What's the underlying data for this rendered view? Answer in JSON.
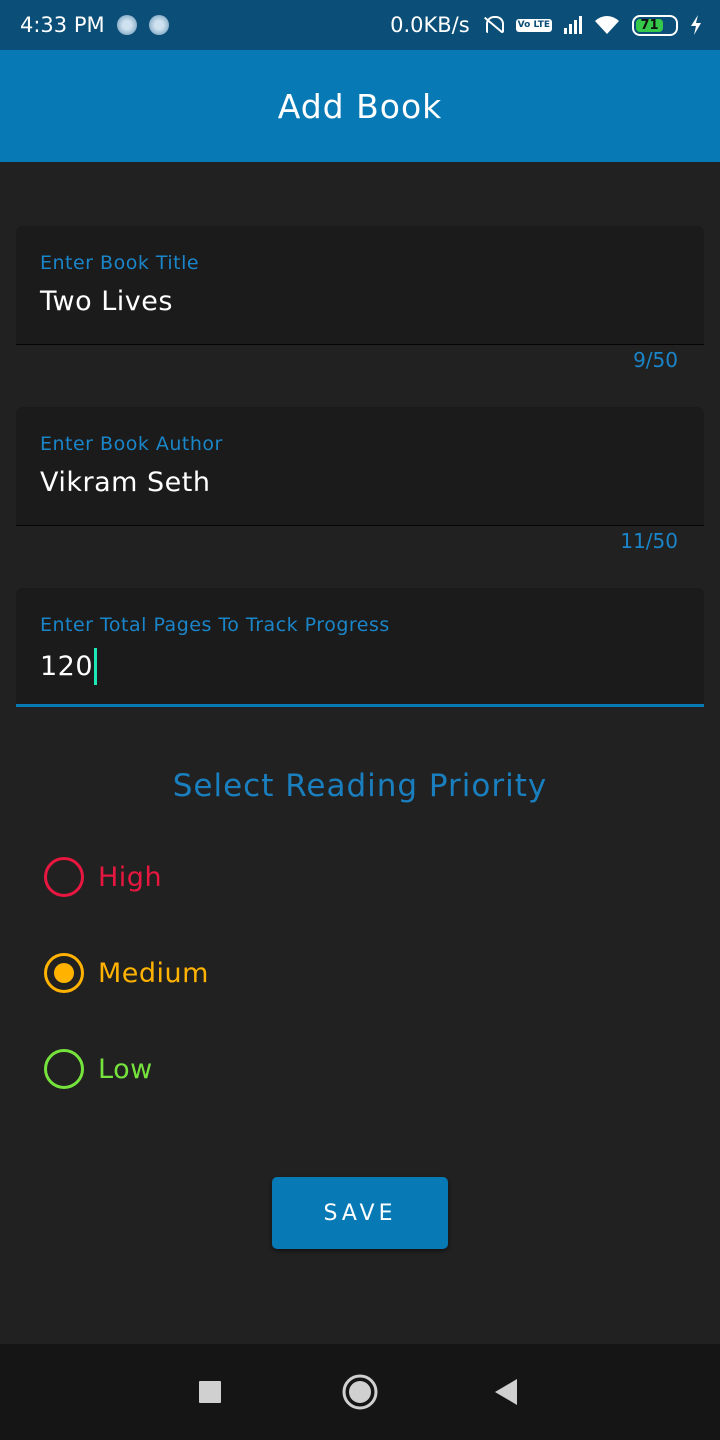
{
  "status_bar": {
    "time": "4:33 PM",
    "network_speed": "0.0KB/s",
    "battery_level": "71",
    "volte_label": "Vo LTE",
    "icons": [
      "sync-dot-icon",
      "sync-dot-icon",
      "mute-bell-icon",
      "volte-icon",
      "signal-icon",
      "wifi-icon",
      "battery-icon",
      "charging-bolt-icon"
    ]
  },
  "app_bar": {
    "title": "Add Book"
  },
  "form": {
    "title_field": {
      "label": "Enter Book Title",
      "value": "Two Lives",
      "counter": "9/50"
    },
    "author_field": {
      "label": "Enter Book Author",
      "value": "Vikram Seth",
      "counter": "11/50"
    },
    "pages_field": {
      "label": "Enter Total Pages To Track Progress",
      "value": "120"
    }
  },
  "priority": {
    "title": "Select Reading Priority",
    "selected": "Medium",
    "options": [
      {
        "label": "High",
        "color": "#e8173f",
        "checked": false
      },
      {
        "label": "Medium",
        "color": "#ffb300",
        "checked": true
      },
      {
        "label": "Low",
        "color": "#76e33d",
        "checked": false
      }
    ]
  },
  "actions": {
    "save_label": "SAVE"
  },
  "colors": {
    "primary": "#0779b4",
    "status_bar": "#0b4f78",
    "background": "#212121",
    "accent_cursor": "#1de9b6"
  },
  "nav_bar": {
    "icons": [
      "recents-square-icon",
      "home-circle-icon",
      "back-triangle-icon"
    ]
  }
}
